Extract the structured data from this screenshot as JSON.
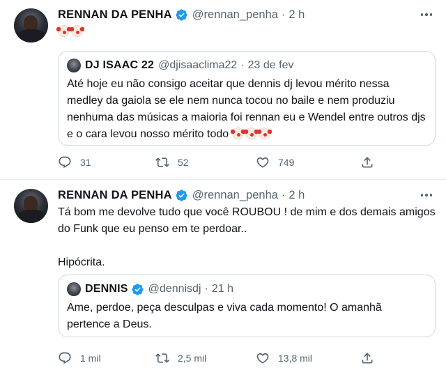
{
  "tweets": [
    {
      "author": {
        "name": "RENNAN DA PENHA",
        "handle": "@rennan_penha"
      },
      "separator": "·",
      "time": "2 h",
      "text": "",
      "quote": {
        "author": {
          "name": "DJ ISAAC 22",
          "handle": "@djisaaclima22"
        },
        "separator": "·",
        "time": "23 de fev",
        "text_lines": [
          "Até hoje eu não consigo aceitar que dennis dj levou mérito nessa",
          "medley da gaiola se ele nem nunca tocou no baile e nem produziu",
          "nenhuma das músicas a maioria foi rennan eu e Wendel entre outros djs",
          "e o cara levou nosso mérito todo"
        ]
      },
      "actions": {
        "replies": "31",
        "retweets": "52",
        "likes": "749"
      }
    },
    {
      "author": {
        "name": "RENNAN DA PENHA",
        "handle": "@rennan_penha"
      },
      "separator": "·",
      "time": "2 h",
      "text_lines": [
        "Tá bom me devolve tudo que você ROUBOU ! de mim e dos demais amigos",
        "do Funk que eu penso em te perdoar..",
        "",
        "Hipócrita."
      ],
      "quote": {
        "author": {
          "name": "DENNIS",
          "handle": "@dennisdj"
        },
        "separator": "·",
        "time": "21 h",
        "text_lines": [
          "Ame, perdoe, peça desculpas e viva cada momento! O amanhã",
          "pertence a Deus."
        ]
      },
      "actions": {
        "replies": "1 mil",
        "retweets": "2,5 mil",
        "likes": "13,8 mil"
      }
    }
  ],
  "icons": {
    "verified": "verified-badge-icon",
    "more": "more-icon",
    "reply": "reply-icon",
    "retweet": "retweet-icon",
    "like": "heart-icon",
    "share": "share-icon",
    "emoji": "clown-face-emoji"
  },
  "colors": {
    "verified": "#1d9bf0",
    "secondary_text": "#536471",
    "border": "#cfd9de"
  }
}
